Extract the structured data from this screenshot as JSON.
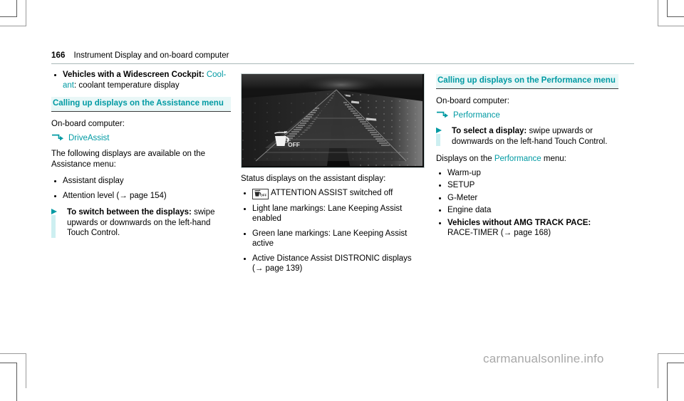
{
  "header": {
    "page_number": "166",
    "title": "Instrument Display and on-board computer"
  },
  "column_left": {
    "bullet_widescreen": {
      "bold_lead": "Vehicles with a Widescreen Cockpit:",
      "teal_term": "Cool-ant",
      "rest": ": coolant temperature display"
    },
    "section_heading": "Calling up displays on the Assistance menu",
    "obc_label": "On-board computer:",
    "obc_path": "DriveAssist",
    "intro": "The following displays are available on the Assistance menu:",
    "list": [
      "Assistant display",
      "Attention level (→ page 154)"
    ],
    "action": {
      "bold_lead": "To switch between the displays:",
      "rest": " swipe upwards or downwards on the left-hand Touch Control."
    }
  },
  "column_middle": {
    "figure_alt": "assistant-display-road-view",
    "figure_icon_label": "OFF",
    "status_intro": "Status displays on the assistant display:",
    "status_list": [
      {
        "icon": "attention-assist-off-icon",
        "text": "ATTENTION ASSIST switched off"
      },
      {
        "icon": "",
        "text": "Light lane markings: Lane Keeping Assist enabled"
      },
      {
        "icon": "",
        "text": "Green lane markings: Lane Keeping Assist active"
      },
      {
        "icon": "",
        "text": "Active Distance Assist DISTRONIC displays (→ page 139)"
      }
    ]
  },
  "column_right": {
    "section_heading": "Calling up displays on the Performance menu",
    "obc_label": "On-board computer:",
    "obc_path": "Performance",
    "action": {
      "bold_lead": "To select a display:",
      "rest": " swipe upwards or downwards on the left-hand Touch Control."
    },
    "displays_intro_pre": "Displays on the ",
    "displays_intro_teal": "Performance",
    "displays_intro_post": " menu:",
    "list": [
      {
        "bold_lead": "",
        "text": "Warm-up"
      },
      {
        "bold_lead": "",
        "text": "SETUP"
      },
      {
        "bold_lead": "",
        "text": "G-Meter"
      },
      {
        "bold_lead": "",
        "text": "Engine data"
      },
      {
        "bold_lead": "Vehicles without AMG TRACK PACE:",
        "text": " RACE-TIMER (→ page 168)"
      }
    ]
  },
  "watermark": "carmanualsonline.info",
  "colors": {
    "accent_teal": "#009aa3",
    "highlight_bg": "#e9f7f7",
    "action_bar": "#cdeff1",
    "rule": "#aab8b8"
  }
}
